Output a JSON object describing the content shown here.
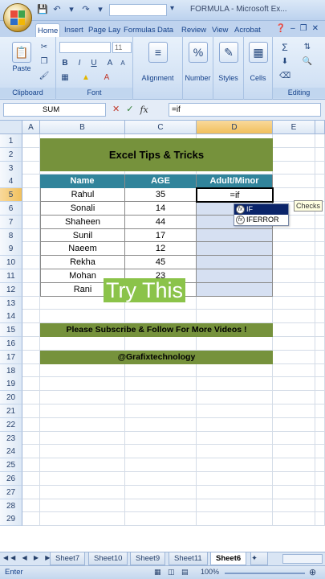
{
  "window": {
    "title": "FORMULA - Microsoft Ex..."
  },
  "ribbon": {
    "tabs": [
      "Home",
      "Insert",
      "Page Lay",
      "Formulas",
      "Data",
      "Review",
      "View",
      "Acrobat"
    ],
    "groups": {
      "clipboard": {
        "label": "Clipboard",
        "paste": "Paste"
      },
      "font": {
        "label": "Font",
        "size": "11"
      },
      "alignment": {
        "label": "Alignment"
      },
      "number": {
        "label": "Number"
      },
      "styles": {
        "label": "Styles"
      },
      "cells": {
        "label": "Cells"
      },
      "editing": {
        "label": "Editing"
      }
    }
  },
  "formula_bar": {
    "name_box": "SUM",
    "formula": "=if"
  },
  "grid": {
    "columns": [
      "A",
      "B",
      "C",
      "D",
      "E"
    ],
    "rows": [
      "1",
      "2",
      "3",
      "4",
      "5",
      "6",
      "7",
      "8",
      "9",
      "10",
      "11",
      "12",
      "13",
      "14",
      "15",
      "16",
      "17",
      "18",
      "19",
      "20",
      "21",
      "22",
      "23",
      "24",
      "25",
      "26",
      "27",
      "28",
      "29"
    ],
    "title": "Excel Tips & Tricks",
    "headers": [
      "Name",
      "AGE",
      "Adult/Minor"
    ],
    "records": [
      {
        "name": "Rahul",
        "age": "35"
      },
      {
        "name": "Sonali",
        "age": "14"
      },
      {
        "name": "Shaheen",
        "age": "44"
      },
      {
        "name": "Sunil",
        "age": "17"
      },
      {
        "name": "Naeem",
        "age": "12"
      },
      {
        "name": "Rekha",
        "age": "45"
      },
      {
        "name": "Mohan",
        "age": "23"
      },
      {
        "name": "Rani",
        "age": ""
      }
    ],
    "editing_cell": "=if",
    "subscribe_banner": "Please Subscribe & Follow For More Videos !",
    "handle_banner": "@Grafixtechnology"
  },
  "autocomplete": {
    "items": [
      "IF",
      "IFERROR"
    ],
    "tooltip": "Checks"
  },
  "overlay": {
    "text": "Try This"
  },
  "sheets": {
    "tabs": [
      "Sheet7",
      "Sheet10",
      "Sheet9",
      "Sheet11",
      "Sheet6"
    ],
    "active": "Sheet6"
  },
  "status": {
    "mode": "Enter",
    "zoom": "100%"
  },
  "colors": {
    "banner_green": "#76923c",
    "header_teal": "#31849b",
    "overlay_green": "#8bc34a"
  }
}
